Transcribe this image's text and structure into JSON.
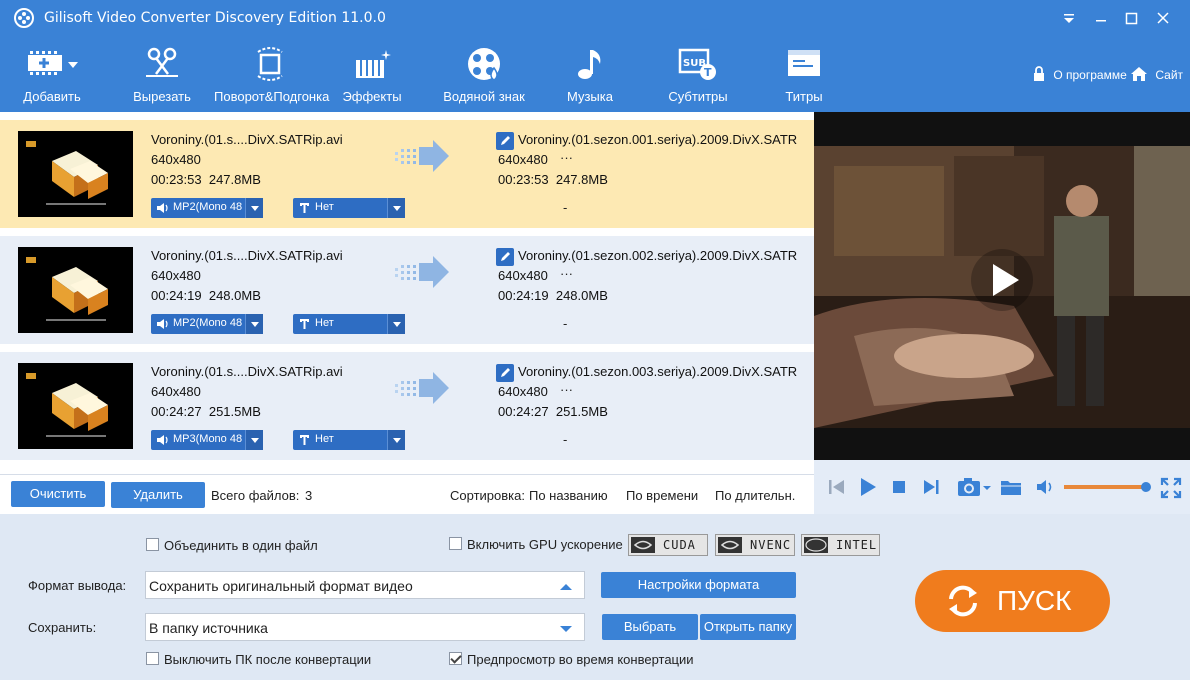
{
  "window": {
    "title": "Gilisoft Video Converter Discovery Edition 11.0.0"
  },
  "toolbar": {
    "items": [
      {
        "label": "Добавить",
        "icon": "add-video-icon"
      },
      {
        "label": "Вырезать",
        "icon": "scissors-icon"
      },
      {
        "label": "Поворот&Подгонка",
        "icon": "crop-rotate-icon"
      },
      {
        "label": "Эффекты",
        "icon": "effects-icon"
      },
      {
        "label": "Водяной знак",
        "icon": "watermark-icon"
      },
      {
        "label": "Музыка",
        "icon": "music-note-icon"
      },
      {
        "label": "Субтитры",
        "icon": "subtitle-icon"
      },
      {
        "label": "Титры",
        "icon": "titles-icon"
      }
    ],
    "about_label": "О программе",
    "site_label": "Сайт"
  },
  "files": [
    {
      "src_name": "Voroniny.(01.s....DivX.SATRip.avi",
      "src_res": "640x480",
      "src_duration": "00:23:53",
      "src_size": "247.8MB",
      "dst_name": "Voroniny.(01.sezon.001.seriya).2009.DivX.SATR",
      "dst_res": "640x480",
      "dst_extra": "···",
      "dst_duration": "00:23:53",
      "dst_size": "247.8MB",
      "audio": "MP2(Mono 48",
      "subtitle": "Нет",
      "dash": "-"
    },
    {
      "src_name": "Voroniny.(01.s....DivX.SATRip.avi",
      "src_res": "640x480",
      "src_duration": "00:24:19",
      "src_size": "248.0MB",
      "dst_name": "Voroniny.(01.sezon.002.seriya).2009.DivX.SATR",
      "dst_res": "640x480",
      "dst_extra": "···",
      "dst_duration": "00:24:19",
      "dst_size": "248.0MB",
      "audio": "MP2(Mono 48",
      "subtitle": "Нет",
      "dash": "-"
    },
    {
      "src_name": "Voroniny.(01.s....DivX.SATRip.avi",
      "src_res": "640x480",
      "src_duration": "00:24:27",
      "src_size": "251.5MB",
      "dst_name": "Voroniny.(01.sezon.003.seriya).2009.DivX.SATR",
      "dst_res": "640x480",
      "dst_extra": "···",
      "dst_duration": "00:24:27",
      "dst_size": "251.5MB",
      "audio": "MP3(Mono 48",
      "subtitle": "Нет",
      "dash": "-"
    }
  ],
  "list_footer": {
    "clear_label": "Очистить",
    "delete_label": "Удалить",
    "total_label": "Всего файлов:",
    "total_count": "3",
    "sort_label": "Сортировка:",
    "sort_by_name": "По названию",
    "sort_by_time": "По времени",
    "sort_by_duration": "По длительн."
  },
  "bottom": {
    "merge_label": "Объединить в один файл",
    "merge_checked": false,
    "gpu_label": "Включить GPU ускорение",
    "gpu_checked": false,
    "gpu_badges": [
      "CUDA",
      "NVENC",
      "INTEL"
    ],
    "format_label": "Формат вывода:",
    "format_value": "Сохранить оригинальный формат видео",
    "format_settings_label": "Настройки формата",
    "save_label": "Сохранить:",
    "save_value": "В папку источника",
    "browse_label": "Выбрать",
    "open_folder_label": "Открыть папку",
    "shutdown_label": "Выключить ПК после конвертации",
    "shutdown_checked": false,
    "preview_label": "Предпросмотр во время конвертации",
    "preview_checked": true,
    "start_label": "ПУСК"
  },
  "player": {
    "volume_fraction": 0.98
  },
  "colors": {
    "accent": "#3a82d6",
    "selected_row": "#fde9b3",
    "row": "#e8eef7",
    "start": "#f07c1d"
  }
}
